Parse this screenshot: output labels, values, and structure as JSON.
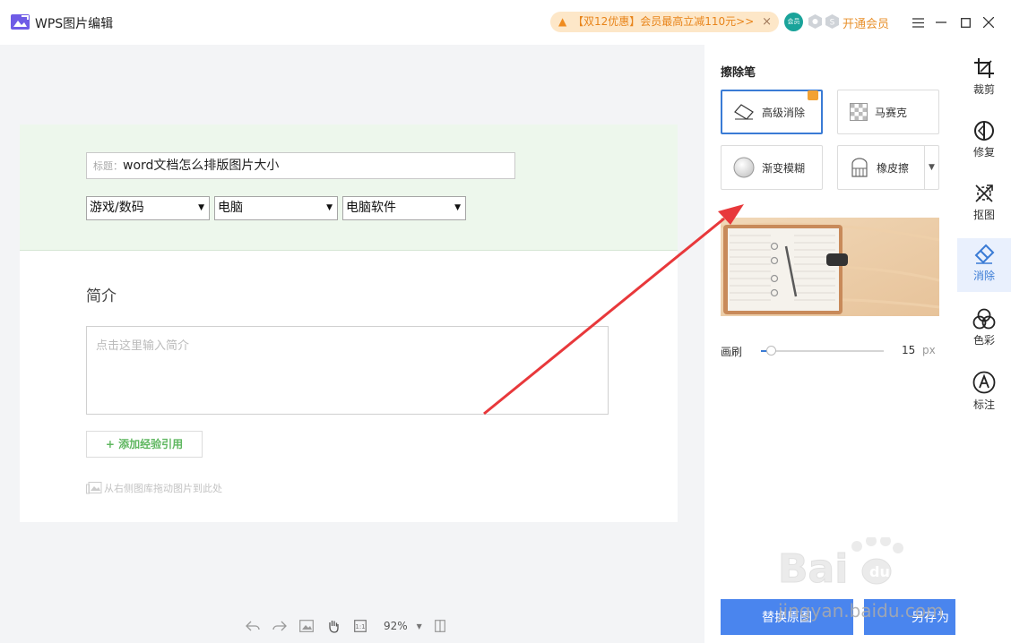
{
  "app": {
    "title": "WPS图片编辑"
  },
  "header": {
    "promo_icon": "speaker-icon",
    "promo_text": "【双12优惠】会员最高立减110元>>",
    "promo_close": "×",
    "badge_a": "会员",
    "vip_label": "开通会员"
  },
  "document": {
    "title_label": "标题：",
    "title_value": "word文档怎么排版图片大小",
    "category_1": "游戏/数码",
    "category_2": "电脑",
    "category_3": "电脑软件",
    "intro_heading": "简介",
    "intro_placeholder": "点击这里输入简介",
    "add_reference": "+ 添加经验引用",
    "drag_hint": "从右侧图库拖动图片到此处"
  },
  "bottombar": {
    "zoom": "92%"
  },
  "panel": {
    "title": "擦除笔",
    "tools": {
      "advanced_erase": "高级消除",
      "mosaic": "马赛克",
      "gradient_blur": "渐变模糊",
      "eraser": "橡皮擦"
    },
    "brush_label": "画刷",
    "brush_value": "15",
    "brush_fraction": 0.08,
    "brush_unit": "px",
    "replace_button": "替换原图",
    "save_as_button": "另存为"
  },
  "toolbar": {
    "crop": "裁剪",
    "repair": "修复",
    "cutout": "抠图",
    "erase": "消除",
    "color": "色彩",
    "annotate": "标注"
  },
  "watermark": {
    "text": "jingyan.baidu.com"
  },
  "colors": {
    "accent": "#3a7bd5",
    "primary_button": "#4a85ee",
    "vip": "#e8912d",
    "doc_header": "#edf7ec",
    "arrow": "#e8383b"
  }
}
